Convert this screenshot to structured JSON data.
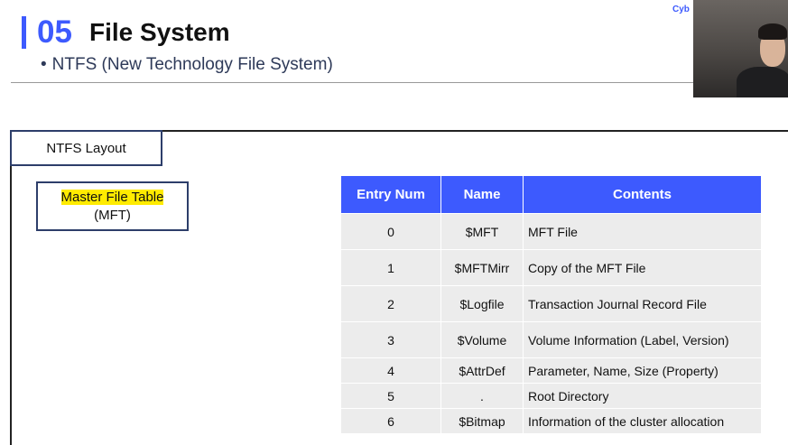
{
  "header": {
    "section_number": "05",
    "section_title": "File System",
    "subtitle_bullet": "•",
    "subtitle": "NTFS (New Technology File System)"
  },
  "webcam": {
    "label": "Cyb"
  },
  "layout": {
    "tab_label": "NTFS Layout",
    "mft_box": {
      "highlighted_label": "Master File Table",
      "abbrev": "(MFT)"
    }
  },
  "table": {
    "headers": [
      "Entry Num",
      "Name",
      "Contents"
    ],
    "rows": [
      {
        "num": "0",
        "name": "$MFT",
        "contents": "MFT File"
      },
      {
        "num": "1",
        "name": "$MFTMirr",
        "contents": "Copy of the MFT File"
      },
      {
        "num": "2",
        "name": "$Logfile",
        "contents": "Transaction Journal Record File"
      },
      {
        "num": "3",
        "name": "$Volume",
        "contents": "Volume Information (Label, Version)"
      },
      {
        "num": "4",
        "name": "$AttrDef",
        "contents": "Parameter, Name, Size (Property)"
      },
      {
        "num": "5",
        "name": ".",
        "contents": "Root Directory"
      },
      {
        "num": "6",
        "name": "$Bitmap",
        "contents": "Information of the cluster allocation"
      }
    ]
  },
  "colors": {
    "accent": "#3d5afe",
    "highlight": "#ffeb00",
    "cell_bg": "#ececec",
    "box_border": "#2d3e6a"
  }
}
